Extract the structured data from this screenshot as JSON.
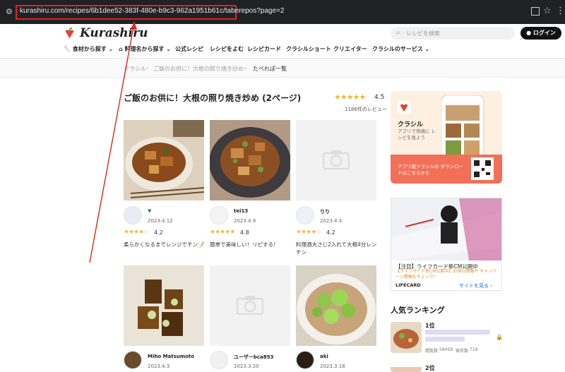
{
  "browser": {
    "url": "kurashiru.com/recipes/6b1dee52-383f-480e-b9c3-962a1951b61c/taberepos?page=2"
  },
  "header": {
    "logo": "Kurashiru",
    "search_placeholder": "レシピを検索",
    "login_label": "ログイン"
  },
  "nav": {
    "items": [
      "食材から探す",
      "料理名から探す",
      "公式レシピ",
      "レシピをよむ",
      "レシピカード",
      "クラシルショート",
      "クリエイター",
      "クラシルのサービス"
    ]
  },
  "breadcrumb": [
    "クラシル",
    "ご飯のお供に！大根の照り焼き炒め",
    "たべれぽ一覧"
  ],
  "page": {
    "title": "ご飯のお供に！大根の照り焼き炒め (2ページ)",
    "rating": "4.5",
    "review_count": "1186件のレビュー"
  },
  "reviews": [
    {
      "user": "",
      "date": "2023.4.12",
      "rating": "4.2",
      "stars": 4.2,
      "comment": "柔らかくなるまでレンジでチン📝"
    },
    {
      "user": "tei13",
      "date": "2023.4.9",
      "rating": "4.8",
      "stars": 4.8,
      "comment": "簡単で美味しい！リピする！"
    },
    {
      "user": "りり",
      "date": "2023.4.4",
      "rating": "4.2",
      "stars": 4.2,
      "comment": "料理酒大さじ2入れて大根4分レンチン"
    },
    {
      "user": "Miho Matsumoto",
      "date": "2023.4.3",
      "rating": "",
      "stars": 0,
      "comment": ""
    },
    {
      "user": "ユーザーbca853",
      "date": "2023.3.20",
      "rating": "",
      "stars": 0,
      "comment": ""
    },
    {
      "user": "aki",
      "date": "2023.3.18",
      "rating": "",
      "stars": 0,
      "comment": ""
    }
  ],
  "sidebar": {
    "app": {
      "name": "クラシル",
      "desc": "アプリで快適に レシピを見よう",
      "download": "アプリ版クラシルの ダウンロードはこちらから"
    },
    "ad": {
      "title": "【注目】ライフカード新CM公開中",
      "sub": "【ライフカード新CM公開中】お得な情報や キャンペーン情報をチェック！",
      "brand": "LIFECARD",
      "link": "サイトを見る ›"
    },
    "ranking": {
      "heading": "人気ランキング",
      "items": [
        {
          "pos": "1位",
          "views_label": "閲覧数",
          "views": "58459",
          "saves_label": "保存数",
          "saves": "719"
        },
        {
          "pos": "2位"
        }
      ]
    }
  }
}
